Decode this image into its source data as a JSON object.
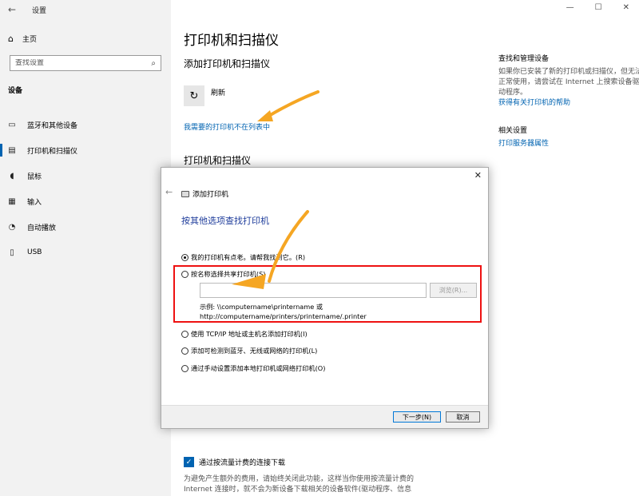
{
  "window": {
    "app_title": "设置",
    "back_icon": "back-arrow-icon"
  },
  "sidebar": {
    "home_label": "主页",
    "search_placeholder": "查找设置",
    "section_label": "设备",
    "items": [
      {
        "label": "蓝牙和其他设备",
        "icon": "bluetooth-icon"
      },
      {
        "label": "打印机和扫描仪",
        "icon": "printer-icon",
        "active": true
      },
      {
        "label": "鼠标",
        "icon": "mouse-icon"
      },
      {
        "label": "输入",
        "icon": "keyboard-icon"
      },
      {
        "label": "自动播放",
        "icon": "autoplay-icon"
      },
      {
        "label": "USB",
        "icon": "usb-icon"
      }
    ]
  },
  "main": {
    "page_title": "打印机和扫描仪",
    "add_section_title": "添加打印机和扫描仪",
    "refresh_label": "刷新",
    "not_listed_link": "我需要的打印机不在列表中",
    "printers_section_title": "打印机和扫描仪",
    "right": {
      "troubleshoot_title": "查找和管理设备",
      "troubleshoot_text": "如果你已安装了新的打印机或扫描仪，但无法正常使用，请尝试在 Internet 上搜索设备驱动程序。",
      "help_link": "获得有关打印机的帮助",
      "related_title": "相关设置",
      "server_link": "打印服务器属性"
    },
    "metered_label": "通过按流量计费的连接下载",
    "metered_desc": "为避免产生额外的费用，请始终关闭此功能，这样当你使用按流量计费的 Internet 连接时，就不会为新设备下载相关的设备软件(驱动程序、信息"
  },
  "dialog": {
    "header": "添加打印机",
    "title": "按其他选项查找打印机",
    "options": [
      {
        "label": "我的打印机有点老。请帮我找到它。(R)",
        "selected": true
      },
      {
        "label": "按名称选择共享打印机(S)",
        "selected": false
      },
      {
        "label": "使用 TCP/IP 地址或主机名添加打印机(I)",
        "selected": false
      },
      {
        "label": "添加可检测到蓝牙、无线或网络的打印机(L)",
        "selected": false
      },
      {
        "label": "通过手动设置添加本地打印机或网络打印机(O)",
        "selected": false
      }
    ],
    "share_input_value": "",
    "browse_label": "浏览(R)...",
    "example_line1": "示例: \\\\computername\\printername 或",
    "example_line2": "http://computername/printers/printername/.printer",
    "next_label": "下一步(N)",
    "cancel_label": "取消"
  },
  "colors": {
    "accent": "#0063b1",
    "annotation_arrow": "#f5a623",
    "highlight_box": "#e11111"
  }
}
